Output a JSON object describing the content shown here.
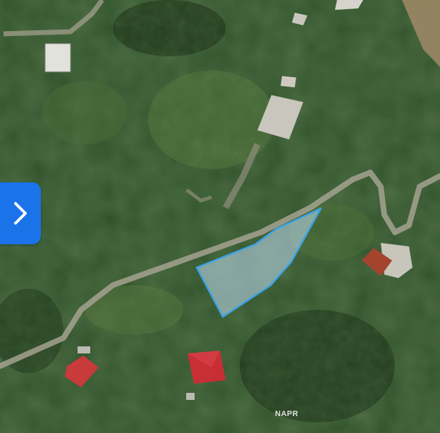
{
  "map": {
    "type": "satellite-imagery",
    "watermark_text": "NAPR",
    "parcel_highlight": {
      "fill_color": "#b8d4e6",
      "stroke_color": "#3aa3e6"
    }
  },
  "controls": {
    "next_button": {
      "icon": "chevron-right-icon",
      "color": "#1a73e8"
    }
  }
}
